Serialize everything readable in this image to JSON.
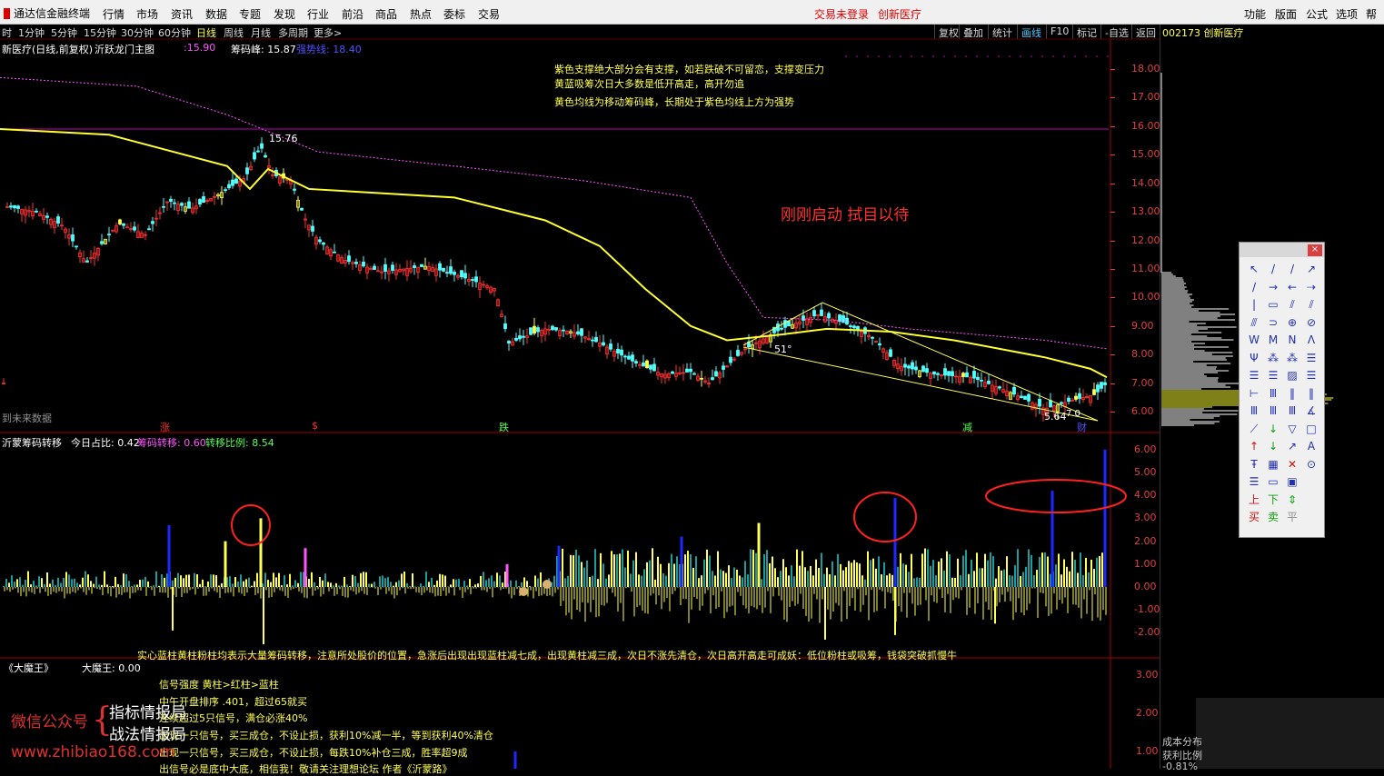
{
  "app": {
    "name": "通达信金融终端"
  },
  "menu": [
    "行情",
    "市场",
    "资讯",
    "数据",
    "专题",
    "发现",
    "行业",
    "前沿",
    "商品",
    "热点",
    "委标",
    "交易"
  ],
  "status": {
    "login": "交易未登录",
    "stock": "创新医疗"
  },
  "right_menu": [
    "功能",
    "版面",
    "公式",
    "选项",
    "帮助"
  ],
  "periods": [
    "时",
    "1分钟",
    "5分钟",
    "15分钟",
    "30分钟",
    "60分钟",
    "日线",
    "周线",
    "月线",
    "多周期",
    "更多>"
  ],
  "active_period": "日线",
  "toolbar_buttons": [
    "复权",
    "叠加",
    "统计",
    "画线",
    "F10",
    "标记",
    "-自选",
    "返回"
  ],
  "active_button": "画线",
  "stock_head": {
    "code": "002173",
    "name": "创新医疗"
  },
  "main_chart": {
    "title": "新医疗(日线,前复权)",
    "indicator": "沂跃龙门主图",
    "val1": ":15.90",
    "chip_peak": "筹码峰: 15.87",
    "chip_value": "强势线: 18.40",
    "note1": "紫色支撑绝大部分会有支撑，如若跌破不可留恋，支撑变压力",
    "note2": "黄蓝吸筹次日大多数是低开高走，高开勿追",
    "note3": "黄色均线为移动筹码峰，长期处于紫色均线上方为强势",
    "big_text": "刚刚启动 拭目以待",
    "high_label": "15.76",
    "low_label": "5.64",
    "angle1": "51°",
    "angle2": "7.0",
    "future": "到未来数据",
    "markers": [
      "涨",
      "$",
      "跌",
      "减",
      "财"
    ],
    "y_ticks": [
      "18.00",
      "17.00",
      "16.00",
      "15.00",
      "14.00",
      "13.00",
      "12.00",
      "11.00",
      "10.00",
      "9.00",
      "8.00",
      "7.00",
      "6.00"
    ]
  },
  "sub_chart": {
    "name": "沂蒙筹码转移",
    "today_ratio": "今日占比: 0.42",
    "chip_transfer": "筹码转移: 0.60",
    "transfer_ratio": "转移比例: 8.54",
    "y_ticks": [
      "6.00",
      "5.00",
      "4.00",
      "3.00",
      "2.00",
      "1.00",
      "0.00",
      "-1.00",
      "-2.00"
    ],
    "note": "实心蓝柱黄柱粉柱均表示大量筹码转移，注意所处股价的位置，急涨后出现出现蓝柱减七成，出现黄柱减三成，次日不涨先清仓，次日高开高走可成妖：低位粉柱或吸筹，钱袋突破抓慢牛"
  },
  "bottom_chart": {
    "name": "《大魔王》",
    "value": "大魔王: 0.00",
    "y_ticks": [
      "3.00",
      "2.00",
      "1.00"
    ],
    "lines": [
      "信号强度 黄柱>红柱>蓝柱",
      "中午开盘排序 .401，超过65就买",
      "连续超过5只信号，满仓必涨40%",
      "出现一只信号，买三成仓，不设止损，获利10%减一半，等到获利40%清仓",
      "出现一只信号，买三成仓，不设止损，每跌10%补仓三成，胜率超9成",
      "出信号必是底中大底，相信我！敬请关注理想论坛 作者《沂蒙路》"
    ]
  },
  "right_info": {
    "cost_label": "成本分布",
    "profit_label": "获利比例",
    "low_label": "-0.81%"
  },
  "watermark": {
    "wechat": "微信公众号",
    "line1": "指标情报局",
    "line2": "战法情报局",
    "site": "www.zhibiao168.com"
  },
  "colors": {
    "yellow": "#ffff54",
    "magenta": "#ff54ff",
    "blue": "#1c28ff",
    "cyan": "#1c9c9c",
    "red_axis": "#e04040"
  }
}
